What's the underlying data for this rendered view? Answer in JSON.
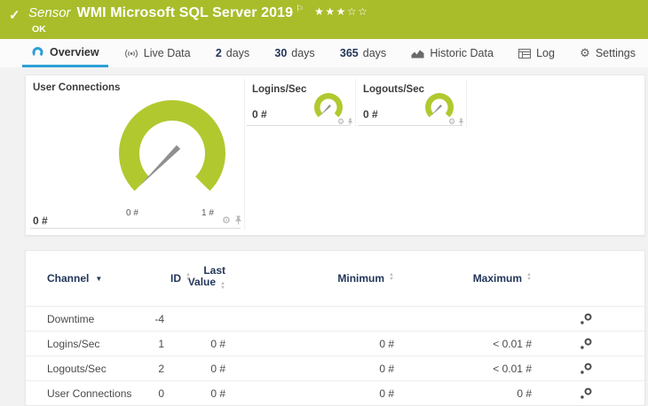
{
  "header": {
    "kind": "Sensor",
    "title": "WMI Microsoft SQL Server 2019",
    "status": "OK",
    "rating_filled": 3,
    "rating_empty": 2
  },
  "icons": {
    "check": "✓",
    "flag": "⚐",
    "star_filled": "★",
    "star_empty": "☆",
    "gear": "⚙",
    "sort_up": "▲",
    "sort_down": "▼"
  },
  "tabs": {
    "overview": "Overview",
    "live": "Live Data",
    "d2_num": "2",
    "d2": "days",
    "d30_num": "30",
    "d30": "days",
    "d365_num": "365",
    "d365": "days",
    "historic": "Historic Data",
    "log": "Log",
    "settings": "Settings"
  },
  "gauges": {
    "primary": {
      "title": "User Connections",
      "value": "0 #",
      "scale_min": "0 #",
      "scale_max": "1 #"
    },
    "logins": {
      "title": "Logins/Sec",
      "value": "0 #"
    },
    "logouts": {
      "title": "Logouts/Sec",
      "value": "0 #"
    }
  },
  "table": {
    "header": {
      "channel": "Channel",
      "id": "ID",
      "last1": "Last",
      "last2": "Value",
      "min": "Minimum",
      "max": "Maximum"
    },
    "rows": [
      {
        "channel": "Downtime",
        "id": "-4",
        "last": "",
        "min": "",
        "max": ""
      },
      {
        "channel": "Logins/Sec",
        "id": "1",
        "last": "0 #",
        "min": "0 #",
        "max": "< 0.01 #"
      },
      {
        "channel": "Logouts/Sec",
        "id": "2",
        "last": "0 #",
        "min": "0 #",
        "max": "< 0.01 #"
      },
      {
        "channel": "User Connections",
        "id": "0",
        "last": "0 #",
        "min": "0 #",
        "max": "0 #"
      }
    ]
  },
  "colors": {
    "header_bg": "#a9bd2b",
    "gauge_green": "#b2c82f",
    "accent_blue": "#2d9fd9",
    "needle_gray": "#8f8f8f"
  }
}
